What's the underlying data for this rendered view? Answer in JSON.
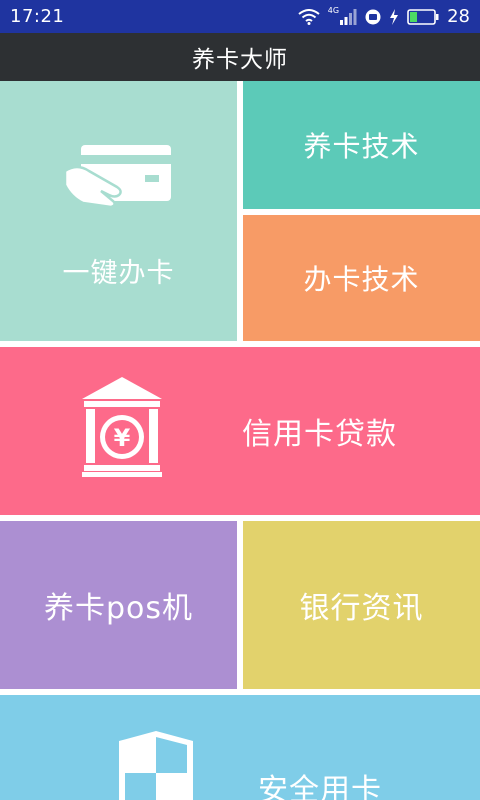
{
  "status_bar": {
    "time": "17:21",
    "network": "4G",
    "battery": "28",
    "icons": [
      "wifi-icon",
      "signal-icon",
      "hd-icon",
      "charging-icon",
      "battery-icon"
    ]
  },
  "app": {
    "title": "养卡大师"
  },
  "tiles": {
    "yijian": {
      "label": "一键办卡",
      "icon": "hand-card-icon",
      "color": "#a8ddd0"
    },
    "yangka": {
      "label": "养卡技术",
      "color": "#5ccab8"
    },
    "banka": {
      "label": "办卡技术",
      "color": "#f79b66"
    },
    "loan": {
      "label": "信用卡贷款",
      "icon": "bank-icon",
      "color": "#fd6a8a"
    },
    "pos": {
      "label": "养卡pos机",
      "color": "#ac8fd2"
    },
    "news": {
      "label": "银行资讯",
      "color": "#e2d26c"
    },
    "safe": {
      "label": "安全用卡",
      "icon": "shield-icon",
      "color": "#7fcde8"
    }
  },
  "colors": {
    "status_bar": "#1f34a0",
    "title_bar": "#2d3033",
    "background": "#ffffff"
  }
}
